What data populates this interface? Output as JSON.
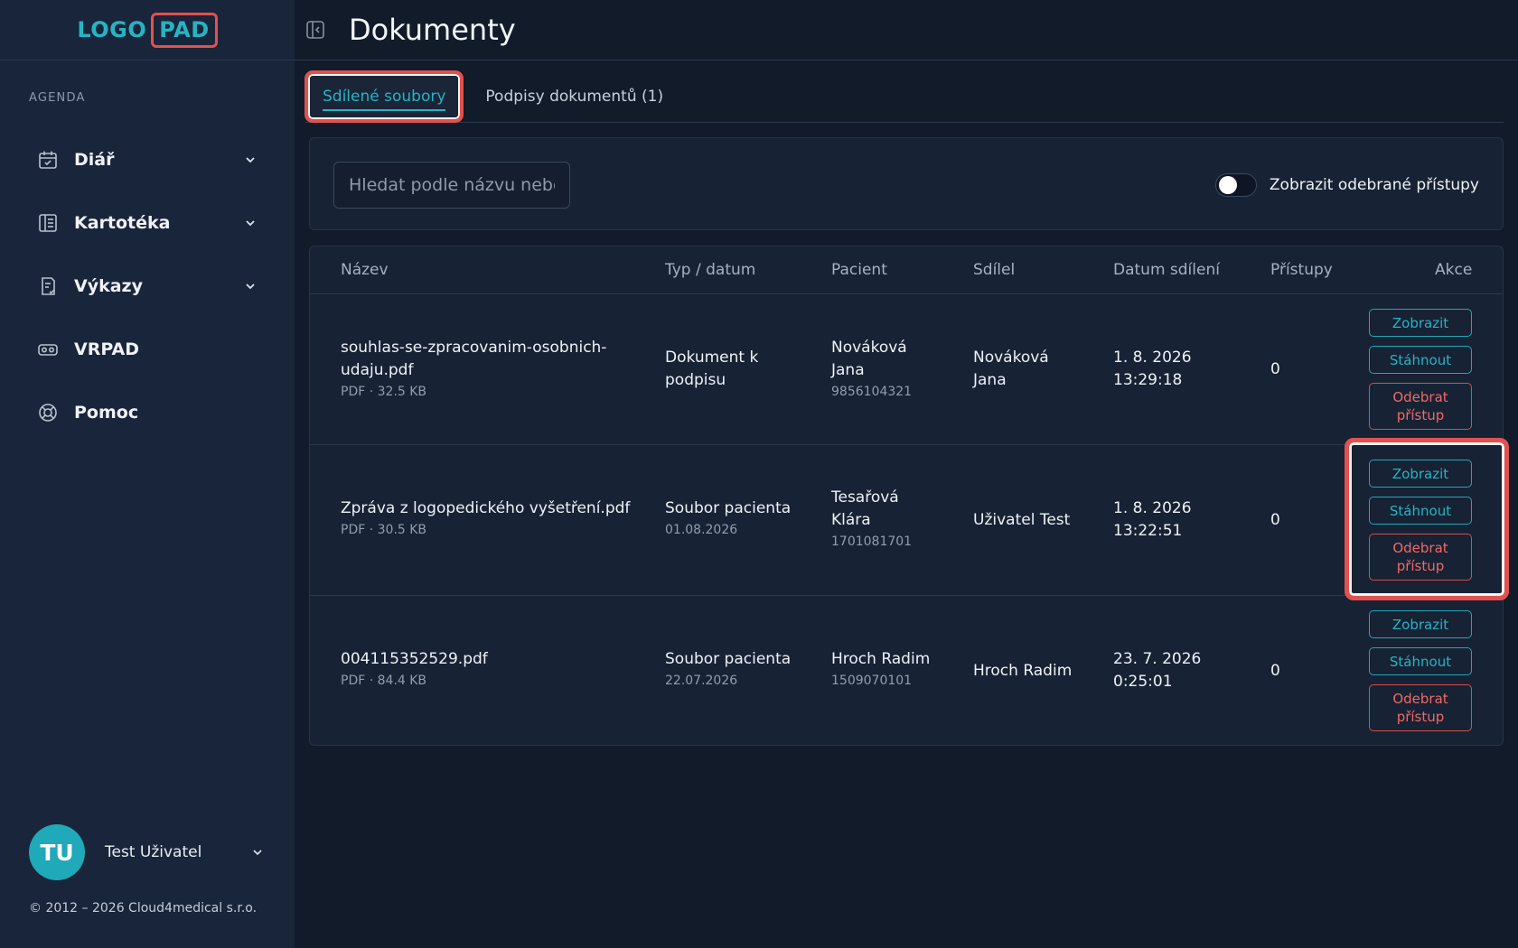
{
  "brand": {
    "logo_part1": "LOGO",
    "logo_part2": "PAD"
  },
  "sidebar": {
    "section_label": "AGENDA",
    "items": [
      {
        "label": "Diář",
        "icon": "calendar-icon",
        "expandable": true
      },
      {
        "label": "Kartotéka",
        "icon": "card-index-icon",
        "expandable": true
      },
      {
        "label": "Výkazy",
        "icon": "report-icon",
        "expandable": true
      },
      {
        "label": "VRPAD",
        "icon": "vr-headset-icon",
        "expandable": false
      },
      {
        "label": "Pomoc",
        "icon": "lifebuoy-icon",
        "expandable": false
      }
    ],
    "user": {
      "initials": "TU",
      "name": "Test Uživatel"
    },
    "copyright": "© 2012 – 2026 Cloud4medical s.r.o."
  },
  "header": {
    "title": "Dokumenty"
  },
  "tabs": [
    {
      "label": "Sdílené soubory",
      "active": true
    },
    {
      "label": "Podpisy dokumentů (1)",
      "active": false
    }
  ],
  "filters": {
    "search_placeholder": "Hledat podle názvu nebo",
    "toggle_label": "Zobrazit odebrané přístupy",
    "toggle_on": false
  },
  "table": {
    "columns": [
      "Název",
      "Typ / datum",
      "Pacient",
      "Sdílel",
      "Datum sdílení",
      "Přístupy",
      "Akce"
    ],
    "rows": [
      {
        "name_line1": "souhlas-se-zpracovanim-osobnich-",
        "name_line2": "udaju.pdf",
        "meta": "PDF · 32.5 KB",
        "type_line1": "Dokument k",
        "type_line2": "podpisu",
        "type_sub": "",
        "patient_line1": "Nováková",
        "patient_line2": "Jana",
        "patient_id": "9856104321",
        "shared_by_line1": "Nováková",
        "shared_by_line2": "Jana",
        "date_line1": "1. 8. 2026",
        "date_line2": "13:29:18",
        "accesses": "0"
      },
      {
        "name_line1": "Zpráva z logopedického vyšetření.pdf",
        "name_line2": "",
        "meta": "PDF · 30.5 KB",
        "type_line1": "Soubor pacienta",
        "type_line2": "",
        "type_sub": "01.08.2026",
        "patient_line1": "Tesařová",
        "patient_line2": "Klára",
        "patient_id": "1701081701",
        "shared_by_line1": "Uživatel Test",
        "shared_by_line2": "",
        "date_line1": "1. 8. 2026",
        "date_line2": "13:22:51",
        "accesses": "0"
      },
      {
        "name_line1": "004115352529.pdf",
        "name_line2": "",
        "meta": "PDF · 84.4 KB",
        "type_line1": "Soubor pacienta",
        "type_line2": "",
        "type_sub": "22.07.2026",
        "patient_line1": "Hroch Radim",
        "patient_line2": "",
        "patient_id": "1509070101",
        "shared_by_line1": "Hroch Radim",
        "shared_by_line2": "",
        "date_line1": "23. 7. 2026",
        "date_line2": "0:25:01",
        "accesses": "0"
      }
    ],
    "actions": {
      "view": "Zobrazit",
      "download": "Stáhnout",
      "revoke_line1": "Odebrat",
      "revoke_line2": "přístup"
    }
  },
  "colors": {
    "accent": "#26b4c4",
    "danger": "#e2514e",
    "sidebar_bg": "#19253a",
    "page_bg": "#111b29"
  }
}
